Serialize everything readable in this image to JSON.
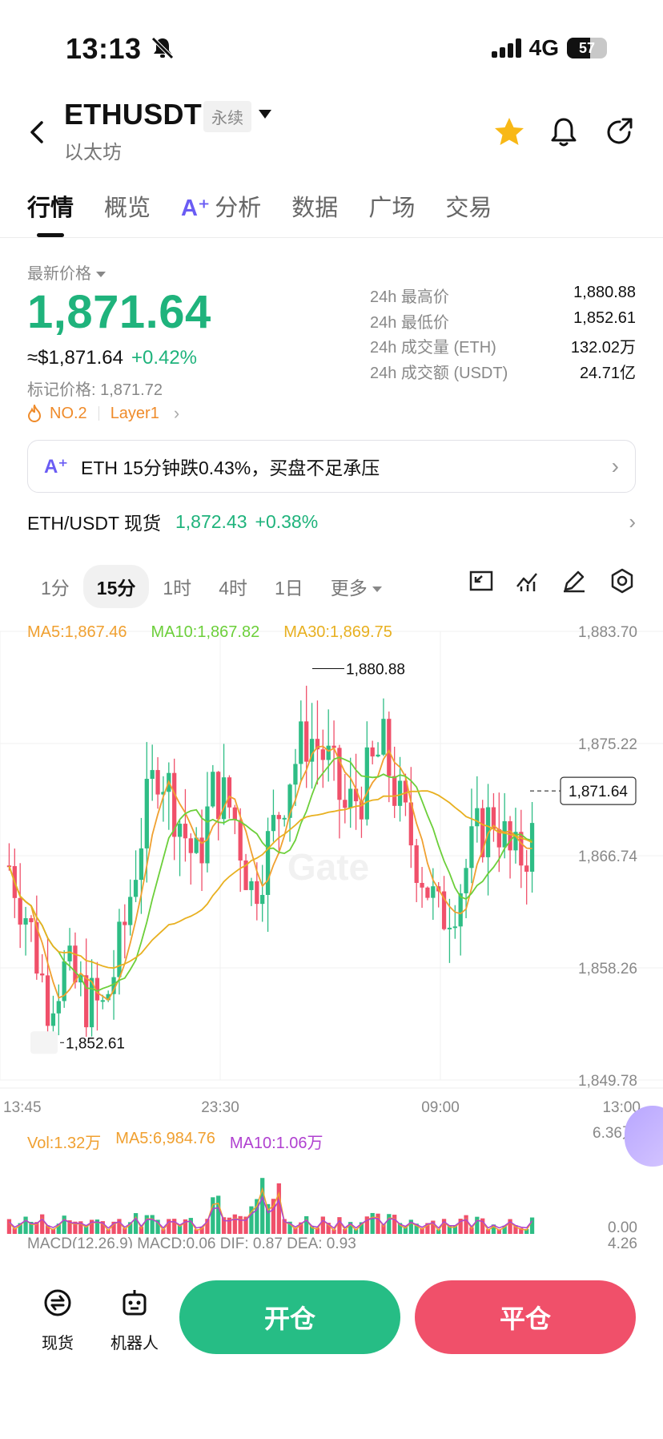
{
  "status_bar": {
    "time": "13:13",
    "network": "4G",
    "battery": "57"
  },
  "header": {
    "title": "ETHUSDT",
    "badge": "永续",
    "subtitle": "以太坊"
  },
  "tabs": [
    {
      "label": "行情",
      "active": true
    },
    {
      "label": "概览"
    },
    {
      "label": "分析",
      "ai": true
    },
    {
      "label": "数据"
    },
    {
      "label": "广场"
    },
    {
      "label": "交易"
    }
  ],
  "price": {
    "label": "最新价格",
    "last": "1,871.64",
    "usd": "≈$1,871.64",
    "change": "+0.42%",
    "mark": "标记价格: 1,871.72",
    "rank": "NO.2",
    "sector": "Layer1"
  },
  "stats": [
    {
      "k": "24h 最高价",
      "v": "1,880.88"
    },
    {
      "k": "24h 最低价",
      "v": "1,852.61"
    },
    {
      "k": "24h 成交量 (ETH)",
      "v": "132.02万"
    },
    {
      "k": "24h 成交额 (USDT)",
      "v": "24.71亿"
    }
  ],
  "ai_banner": {
    "text": "ETH 15分钟跌0.43%，买盘不足承压"
  },
  "spot": {
    "name": "ETH/USDT 现货",
    "price": "1,872.43",
    "change": "+0.38%"
  },
  "intervals": [
    {
      "label": "1分"
    },
    {
      "label": "15分",
      "active": true
    },
    {
      "label": "1时"
    },
    {
      "label": "4时"
    },
    {
      "label": "1日"
    },
    {
      "label": "更多"
    }
  ],
  "ma_legend": [
    {
      "text": "MA5:1,867.46",
      "color": "#f0a030"
    },
    {
      "text": "MA10:1,867.82",
      "color": "#6ccf3a"
    },
    {
      "text": "MA30:1,869.75",
      "color": "#e8b020"
    }
  ],
  "vol_legend": [
    {
      "text": "Vol:1.32万",
      "color": "#f0a030"
    },
    {
      "text": "MA5:6,984.76",
      "color": "#f0a030"
    },
    {
      "text": "MA10:1.06万",
      "color": "#b040d0"
    }
  ],
  "chart_data": {
    "type": "candlestick",
    "y_ticks": [
      "1,883.70",
      "1,875.22",
      "1,866.74",
      "1,858.26",
      "1,849.78"
    ],
    "x_ticks": [
      "13:45",
      "23:30",
      "09:00",
      "13:00"
    ],
    "ylim": [
      1849.78,
      1883.7
    ],
    "current_price_label": "1,871.64",
    "high_label": "1,880.88",
    "low_label": "1,852.61",
    "vol_ticks": [
      "6.36万",
      "0.00"
    ],
    "macd_label": "MACD(12,26,9)",
    "macd_value": "MACD:0.06",
    "dif": "DIF: 0.87",
    "dea": "DEA: 0.93",
    "macd_tick": "4.26",
    "watermark": "Gate",
    "up_color": "#2ebd85",
    "down_color": "#f0506a"
  },
  "bottom": {
    "spot_label": "现货",
    "bot_label": "机器人",
    "open_label": "开仓",
    "close_label": "平仓"
  }
}
